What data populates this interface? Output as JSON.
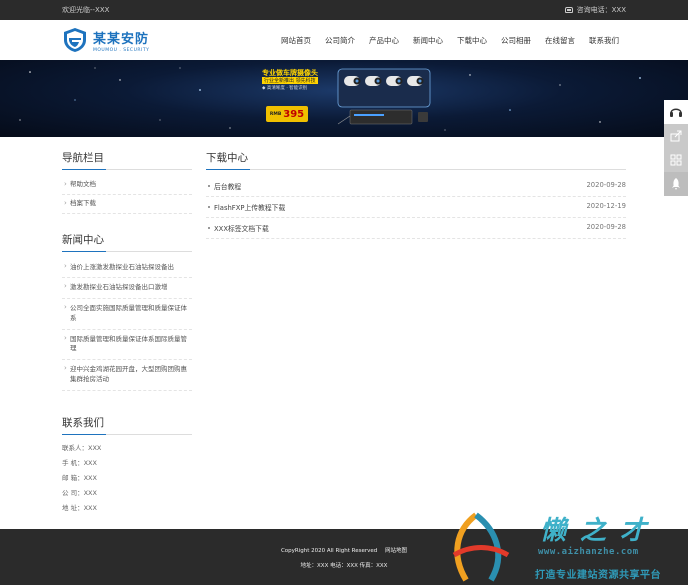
{
  "topbar": {
    "welcome": "欢迎光临--XXX",
    "phone_label": "咨询电话：XXX"
  },
  "header": {
    "logo_cn": "某某安防",
    "logo_en": "MOUMOU . SECURITY",
    "nav": [
      "网站首页",
      "公司简介",
      "产品中心",
      "新闻中心",
      "下载中心",
      "公司相册",
      "在线留言",
      "联系我们"
    ]
  },
  "banner": {
    "tag": "专业做车牌摄像头",
    "sub1": "行业全新推出 领先科技",
    "sub2": "◆ 高清晰度 · 智能识别",
    "price_prefix": "RMB",
    "price": "395"
  },
  "sidebar": {
    "nav_title": "导航栏目",
    "nav_items": [
      "帮助文档",
      "档案下载"
    ],
    "news_title": "新闻中心",
    "news_items": [
      "油价上涨激发勘探业石油钻探设备出",
      "激发勘探业石油钻探设备出口激增",
      "公司全面实施国际质量管理和质量保证体系",
      "国际质量管理和质量保证体系国际质量管理",
      "迎中兴金鸡湖花园开盘，大型团购团购惠集群抢房活动"
    ],
    "contact_title": "联系我们",
    "contact_items": [
      "联系人：XXX",
      "手 机：XXX",
      "邮 箱：XXX",
      "公 司：XXX",
      "地 址：XXX"
    ]
  },
  "content": {
    "title": "下载中心",
    "items": [
      {
        "title": "后台教程",
        "date": "2020-09-28"
      },
      {
        "title": "FlashFXP上传教程下载",
        "date": "2020-12-19"
      },
      {
        "title": "XXX标签文档下载",
        "date": "2020-09-28"
      }
    ]
  },
  "footer": {
    "copyright": "CopyRight 2020 All Right Reserved",
    "sitemap": "网站地图",
    "line2": "地址：XXX  电话：XXX  传真：XXX"
  },
  "watermark": {
    "title": "懒之才",
    "url": "www.aizhanzhe.com",
    "slogan": "打造专业建站资源共享平台"
  },
  "colors": {
    "accent": "#1e73be",
    "topbar_bg": "#2b2b2b",
    "footer_bg": "#2b2b2b"
  },
  "icons": [
    "phone-icon",
    "headset-icon",
    "share-icon",
    "qrcode-icon",
    "rocket-icon",
    "shield-logo-icon"
  ]
}
